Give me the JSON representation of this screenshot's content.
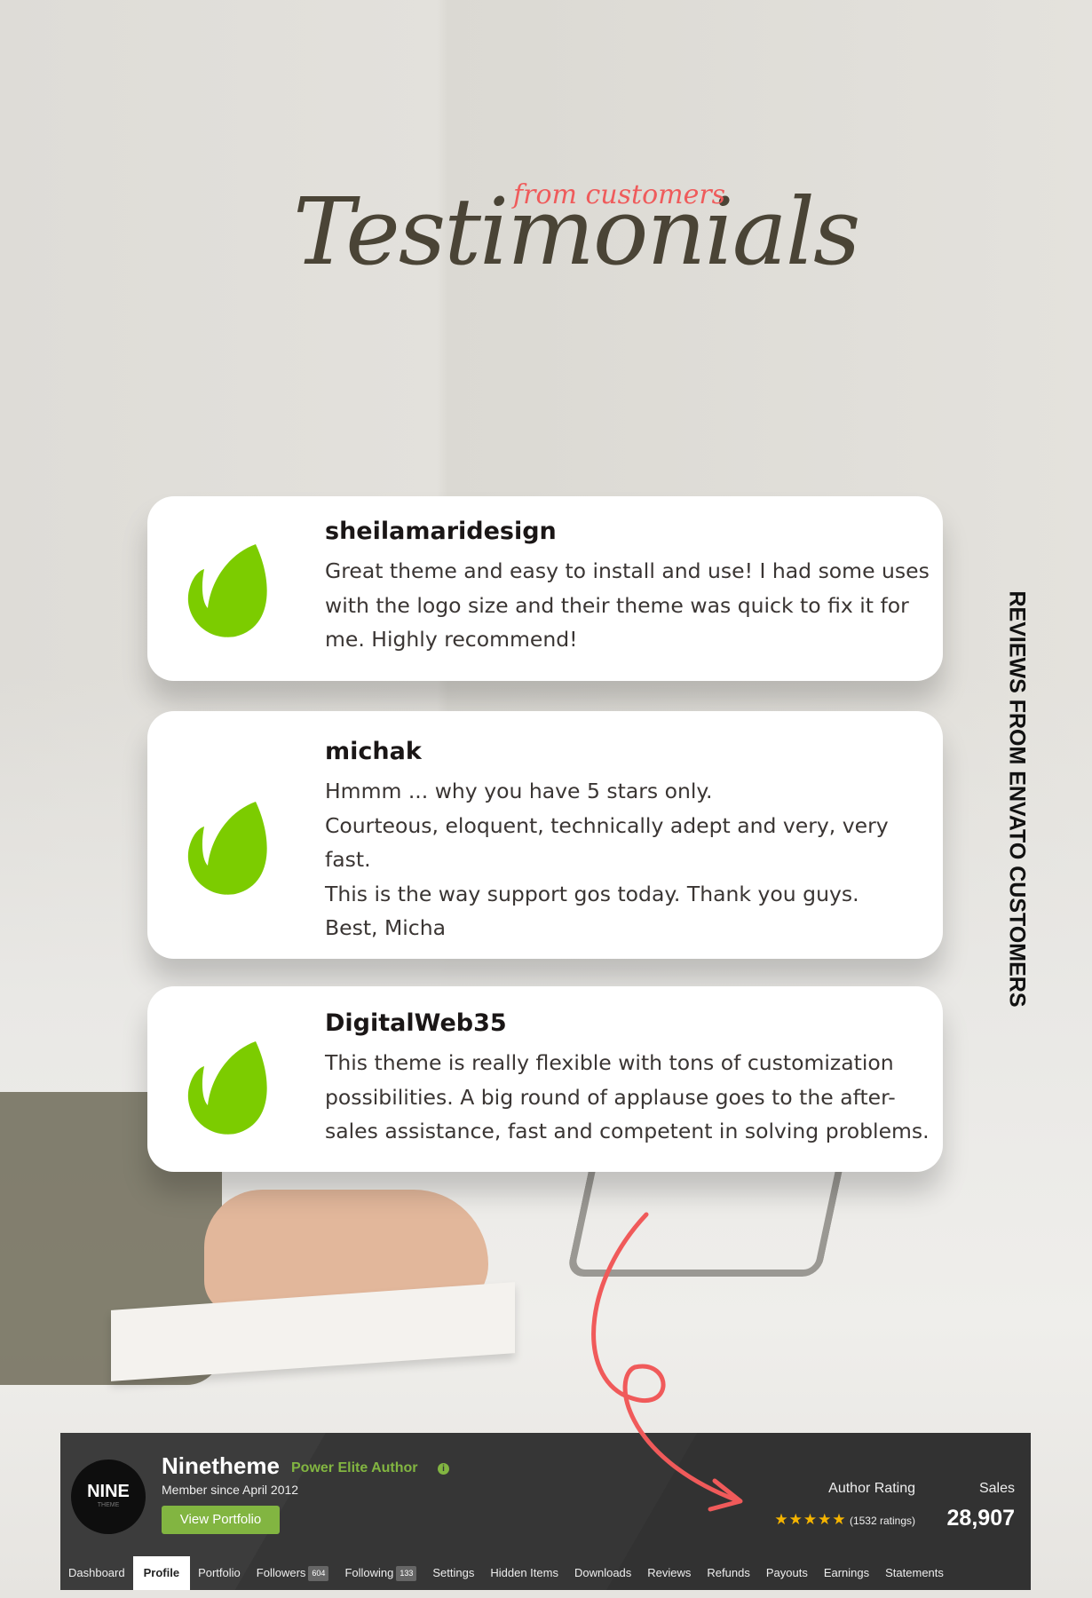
{
  "header": {
    "title": "Testimonials",
    "subtitle": "from customers"
  },
  "side_label": "REVIEWS FROM ENVATO CUSTOMERS",
  "colors": {
    "accent": "#ef5b5b",
    "leaf": "#7ccc00",
    "brand_green": "#82b541",
    "bar_bg": "#363636"
  },
  "reviews": [
    {
      "name": "sheilamaridesign",
      "text": "Great theme and easy to install and use! I had some uses\nwith the logo size and their theme was quick to fix it for\nme. Highly recommend!",
      "icon": "envato-leaf-icon"
    },
    {
      "name": "michak",
      "text": "Hmmm ... why you have 5 stars only.\nCourteous, eloquent, technically adept and very, very fast.\nThis is the way support gos today. Thank you guys.\nBest, Micha",
      "icon": "envato-leaf-icon"
    },
    {
      "name": "DigitalWeb35",
      "text": "This theme is really flexible with tons of customization\npossibilities. A big round of applause goes to the after-\nsales assistance, fast and competent in solving problems.",
      "icon": "envato-leaf-icon"
    }
  ],
  "profile": {
    "avatar_text": "NINE",
    "avatar_sub": "THEME",
    "username": "Ninetheme",
    "badge": "Power Elite Author",
    "info_icon": "i",
    "member_since": "Member since April 2012",
    "view_portfolio": "View Portfolio",
    "rating_label": "Author Rating",
    "stars": "★★★★★",
    "rating_value": 5,
    "ratings": "(1532 ratings)",
    "sales_label": "Sales",
    "sales": "28,907",
    "tabs": [
      {
        "label": "Dashboard"
      },
      {
        "label": "Profile",
        "active": true
      },
      {
        "label": "Portfolio"
      },
      {
        "label": "Followers",
        "count": "604"
      },
      {
        "label": "Following",
        "count": "133"
      },
      {
        "label": "Settings"
      },
      {
        "label": "Hidden Items"
      },
      {
        "label": "Downloads"
      },
      {
        "label": "Reviews"
      },
      {
        "label": "Refunds"
      },
      {
        "label": "Payouts"
      },
      {
        "label": "Earnings"
      },
      {
        "label": "Statements"
      }
    ]
  }
}
